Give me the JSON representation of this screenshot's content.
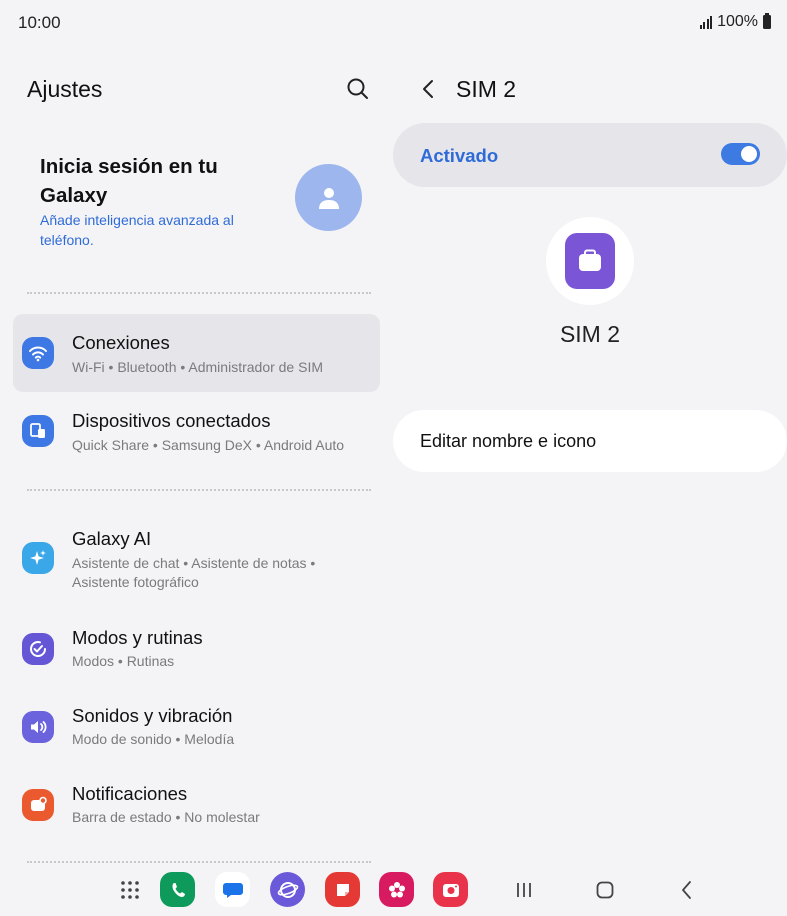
{
  "status_bar": {
    "time": "10:00",
    "battery": "100%"
  },
  "settings": {
    "title": "Ajustes",
    "account": {
      "title": "Inicia sesión en tu Galaxy",
      "subtitle": "Añade inteligencia avanzada al teléfono."
    },
    "items": [
      {
        "title": "Conexiones",
        "subtitle": "Wi-Fi  •  Bluetooth  •  Administrador de SIM",
        "icon": "wifi-icon",
        "color": "#3e78e5"
      },
      {
        "title": "Dispositivos conectados",
        "subtitle": "Quick Share  •  Samsung DeX  •  Android Auto",
        "icon": "devices-icon",
        "color": "#3e78e5"
      },
      {
        "title": "Galaxy AI",
        "subtitle": "Asistente de chat  •  Asistente de notas  •",
        "subtitle2": "Asistente fotográfico",
        "icon": "sparkle-icon",
        "color": "#3aa7e9"
      },
      {
        "title": "Modos y rutinas",
        "subtitle": "Modos  •  Rutinas",
        "icon": "check-circle-icon",
        "color": "#6556d6"
      },
      {
        "title": "Sonidos y vibración",
        "subtitle": "Modo de sonido  •  Melodía",
        "icon": "speaker-icon",
        "color": "#6a63dd"
      },
      {
        "title": "Notificaciones",
        "subtitle": "Barra de estado  •  No molestar",
        "icon": "notification-icon",
        "color": "#ea5a2e"
      }
    ]
  },
  "detail": {
    "title": "SIM 2",
    "toggle_label": "Activado",
    "toggle_on": true,
    "sim_name": "SIM 2",
    "edit_label": "Editar nombre e icono"
  },
  "dock": {
    "apps": [
      "apps-grid-icon",
      "phone-app-icon",
      "messages-app-icon",
      "internet-app-icon",
      "notes-app-icon",
      "gallery-app-icon",
      "camera-app-icon"
    ]
  },
  "colors": {
    "accent": "#2f6bd8",
    "background": "#f4f4f6",
    "sim_icon": "#7a55d6"
  }
}
